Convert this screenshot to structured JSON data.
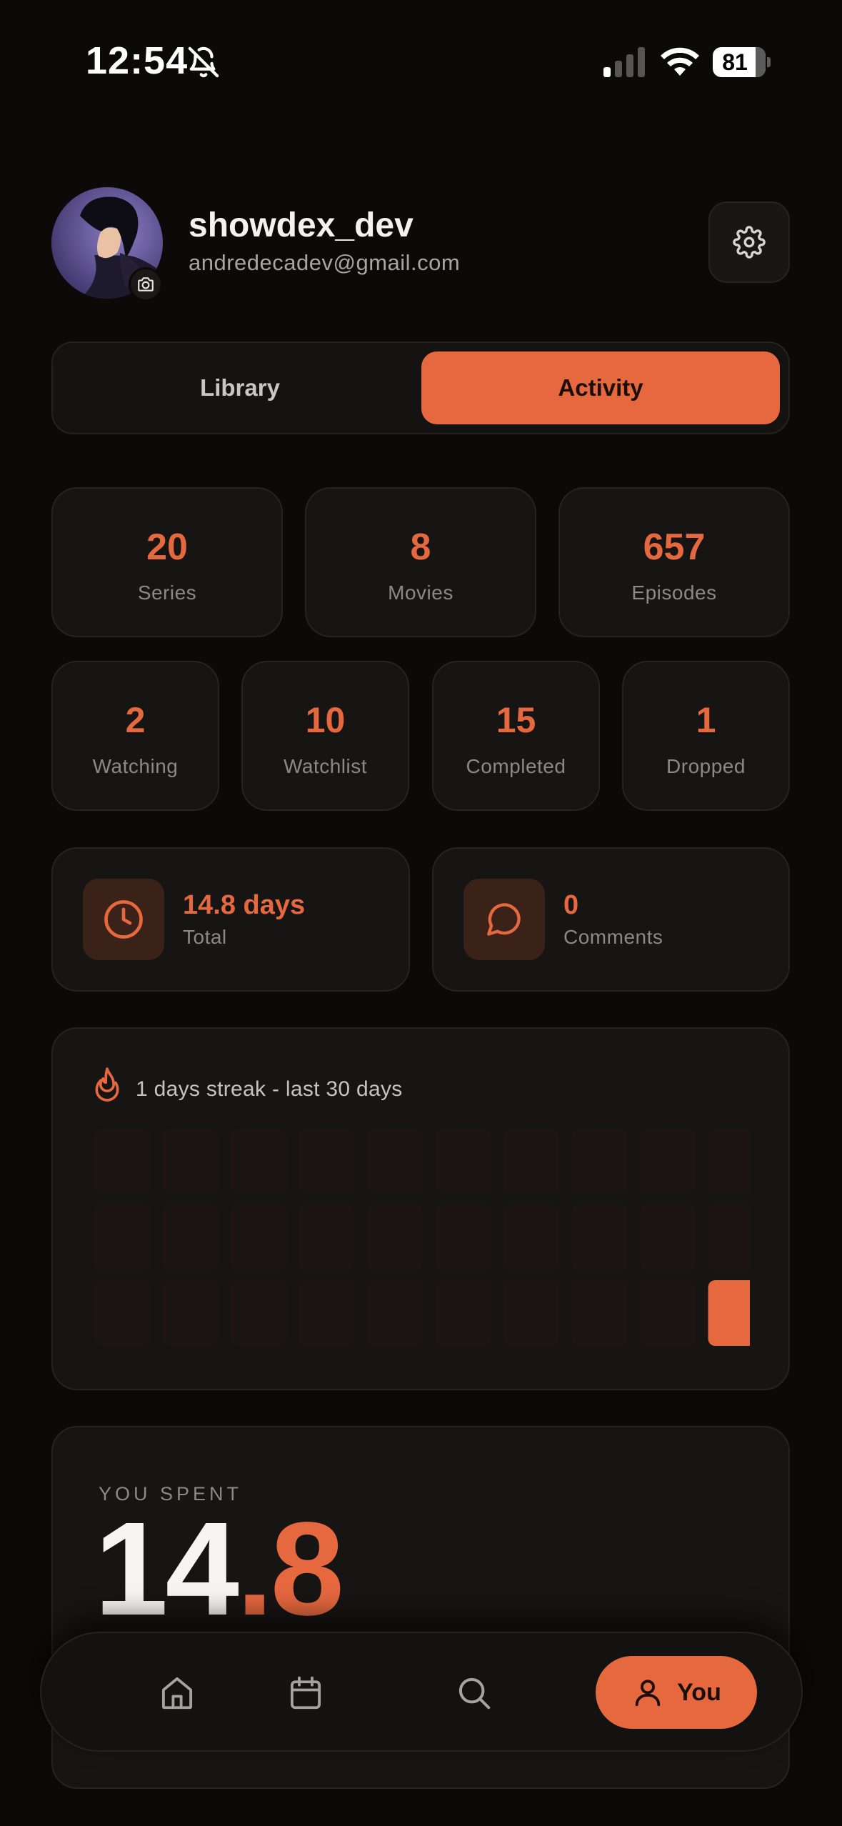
{
  "status_bar": {
    "time": "12:54",
    "battery": "81"
  },
  "profile": {
    "username": "showdex_dev",
    "email": "andredecadev@gmail.com"
  },
  "tabs": [
    {
      "label": "Library",
      "active": false
    },
    {
      "label": "Activity",
      "active": true
    }
  ],
  "stats_top": [
    {
      "value": "20",
      "label": "Series"
    },
    {
      "value": "8",
      "label": "Movies"
    },
    {
      "value": "657",
      "label": "Episodes"
    }
  ],
  "stats_status": [
    {
      "value": "2",
      "label": "Watching"
    },
    {
      "value": "10",
      "label": "Watchlist"
    },
    {
      "value": "15",
      "label": "Completed"
    },
    {
      "value": "1",
      "label": "Dropped"
    }
  ],
  "time_card": {
    "value": "14.8 days",
    "label": "Total",
    "icon": "clock-icon"
  },
  "comments_card": {
    "value": "0",
    "label": "Comments",
    "icon": "comment-icon"
  },
  "streak": {
    "title": "1 days streak - last 30 days",
    "days": 30,
    "active_days": [
      30
    ]
  },
  "spent": {
    "label": "YOU SPENT",
    "value_int": "14",
    "value_dot": ".",
    "value_frac": "8"
  },
  "nav": {
    "items": [
      "home-icon",
      "calendar-icon",
      "search-icon"
    ],
    "active_label": "You"
  },
  "colors": {
    "accent": "#e5683f",
    "background": "#0b0a09",
    "card": "#171514"
  }
}
